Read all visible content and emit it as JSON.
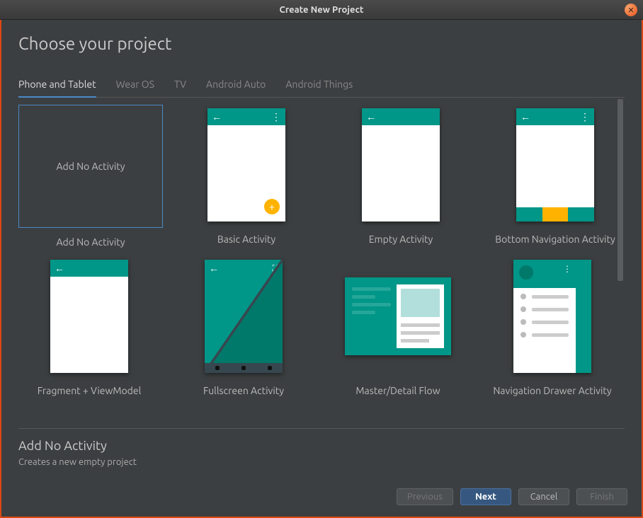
{
  "window": {
    "title": "Create New Project"
  },
  "heading": "Choose your project",
  "tabs": [
    {
      "label": "Phone and Tablet",
      "active": true
    },
    {
      "label": "Wear OS",
      "active": false
    },
    {
      "label": "TV",
      "active": false
    },
    {
      "label": "Android Auto",
      "active": false
    },
    {
      "label": "Android Things",
      "active": false
    }
  ],
  "templates": [
    {
      "label": "Add No Activity",
      "selected": true
    },
    {
      "label": "Basic Activity",
      "selected": false
    },
    {
      "label": "Empty Activity",
      "selected": false
    },
    {
      "label": "Bottom Navigation Activity",
      "selected": false
    },
    {
      "label": "Fragment + ViewModel",
      "selected": false
    },
    {
      "label": "Fullscreen Activity",
      "selected": false
    },
    {
      "label": "Master/Detail Flow",
      "selected": false
    },
    {
      "label": "Navigation Drawer Activity",
      "selected": false
    }
  ],
  "selection": {
    "title": "Add No Activity",
    "description": "Creates a new empty project"
  },
  "footer": {
    "previous": "Previous",
    "next": "Next",
    "cancel": "Cancel",
    "finish": "Finish"
  }
}
